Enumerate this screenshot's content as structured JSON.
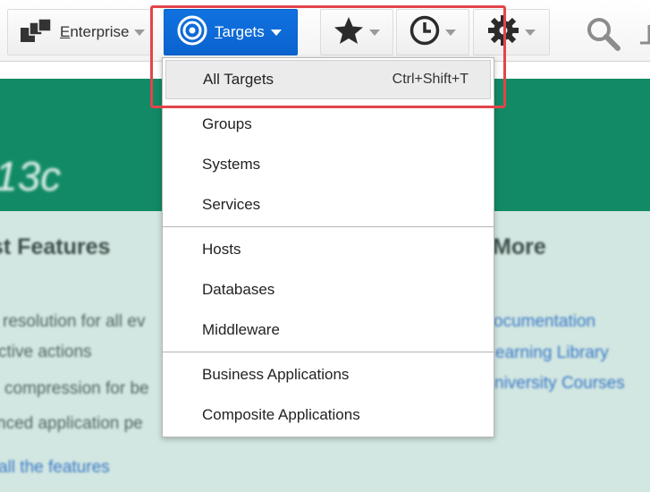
{
  "toolbar": {
    "enterprise": {
      "prefix": "E",
      "rest": "nterprise",
      "icon": "enterprise-icon"
    },
    "targets": {
      "prefix": "T",
      "rest": "argets",
      "icon": "target-icon"
    },
    "favorites": {
      "icon": "star-icon"
    },
    "history": {
      "icon": "clock-icon"
    },
    "setup": {
      "icon": "gear-icon"
    },
    "search": {
      "icon": "search-icon"
    }
  },
  "menu": {
    "items": [
      {
        "label": "All Targets",
        "shortcut": "Ctrl+Shift+T"
      },
      {
        "label": "Groups"
      },
      {
        "label": "Systems"
      },
      {
        "label": "Services"
      },
      {
        "label": "Hosts"
      },
      {
        "label": "Databases"
      },
      {
        "label": "Middleware"
      },
      {
        "label": "Business Applications"
      },
      {
        "label": "Composite Applications"
      }
    ]
  },
  "background": {
    "hero_text": "13c",
    "features_heading": "st Features",
    "more_heading": "More",
    "feature_lines": [
      "resolution for all ev",
      "ctive actions",
      "compression for be",
      "nced application pe"
    ],
    "more_links": [
      "ocumentation",
      "earning Library",
      "niversity Courses"
    ],
    "all_features_link": "all the features"
  },
  "colors": {
    "accent": "#0a63cf",
    "hero": "#118a65",
    "pane": "#d2e7e1",
    "highlight": "#e2454a"
  }
}
